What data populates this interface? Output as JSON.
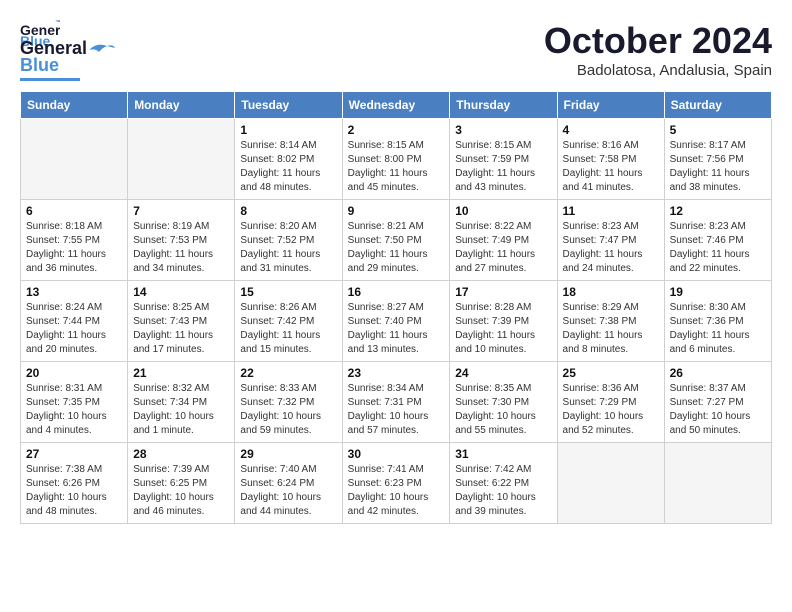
{
  "header": {
    "logo": "GeneralBlue",
    "logo_part1": "General",
    "logo_part2": "Blue",
    "month": "October 2024",
    "location": "Badolatosa, Andalusia, Spain"
  },
  "weekdays": [
    "Sunday",
    "Monday",
    "Tuesday",
    "Wednesday",
    "Thursday",
    "Friday",
    "Saturday"
  ],
  "weeks": [
    [
      {
        "day": "",
        "empty": true
      },
      {
        "day": "",
        "empty": true
      },
      {
        "day": "1",
        "sunrise": "8:14 AM",
        "sunset": "8:02 PM",
        "daylight": "11 hours and 48 minutes."
      },
      {
        "day": "2",
        "sunrise": "8:15 AM",
        "sunset": "8:00 PM",
        "daylight": "11 hours and 45 minutes."
      },
      {
        "day": "3",
        "sunrise": "8:15 AM",
        "sunset": "7:59 PM",
        "daylight": "11 hours and 43 minutes."
      },
      {
        "day": "4",
        "sunrise": "8:16 AM",
        "sunset": "7:58 PM",
        "daylight": "11 hours and 41 minutes."
      },
      {
        "day": "5",
        "sunrise": "8:17 AM",
        "sunset": "7:56 PM",
        "daylight": "11 hours and 38 minutes."
      }
    ],
    [
      {
        "day": "6",
        "sunrise": "8:18 AM",
        "sunset": "7:55 PM",
        "daylight": "11 hours and 36 minutes."
      },
      {
        "day": "7",
        "sunrise": "8:19 AM",
        "sunset": "7:53 PM",
        "daylight": "11 hours and 34 minutes."
      },
      {
        "day": "8",
        "sunrise": "8:20 AM",
        "sunset": "7:52 PM",
        "daylight": "11 hours and 31 minutes."
      },
      {
        "day": "9",
        "sunrise": "8:21 AM",
        "sunset": "7:50 PM",
        "daylight": "11 hours and 29 minutes."
      },
      {
        "day": "10",
        "sunrise": "8:22 AM",
        "sunset": "7:49 PM",
        "daylight": "11 hours and 27 minutes."
      },
      {
        "day": "11",
        "sunrise": "8:23 AM",
        "sunset": "7:47 PM",
        "daylight": "11 hours and 24 minutes."
      },
      {
        "day": "12",
        "sunrise": "8:23 AM",
        "sunset": "7:46 PM",
        "daylight": "11 hours and 22 minutes."
      }
    ],
    [
      {
        "day": "13",
        "sunrise": "8:24 AM",
        "sunset": "7:44 PM",
        "daylight": "11 hours and 20 minutes."
      },
      {
        "day": "14",
        "sunrise": "8:25 AM",
        "sunset": "7:43 PM",
        "daylight": "11 hours and 17 minutes."
      },
      {
        "day": "15",
        "sunrise": "8:26 AM",
        "sunset": "7:42 PM",
        "daylight": "11 hours and 15 minutes."
      },
      {
        "day": "16",
        "sunrise": "8:27 AM",
        "sunset": "7:40 PM",
        "daylight": "11 hours and 13 minutes."
      },
      {
        "day": "17",
        "sunrise": "8:28 AM",
        "sunset": "7:39 PM",
        "daylight": "11 hours and 10 minutes."
      },
      {
        "day": "18",
        "sunrise": "8:29 AM",
        "sunset": "7:38 PM",
        "daylight": "11 hours and 8 minutes."
      },
      {
        "day": "19",
        "sunrise": "8:30 AM",
        "sunset": "7:36 PM",
        "daylight": "11 hours and 6 minutes."
      }
    ],
    [
      {
        "day": "20",
        "sunrise": "8:31 AM",
        "sunset": "7:35 PM",
        "daylight": "10 hours and 4 minutes."
      },
      {
        "day": "21",
        "sunrise": "8:32 AM",
        "sunset": "7:34 PM",
        "daylight": "10 hours and 1 minute."
      },
      {
        "day": "22",
        "sunrise": "8:33 AM",
        "sunset": "7:32 PM",
        "daylight": "10 hours and 59 minutes."
      },
      {
        "day": "23",
        "sunrise": "8:34 AM",
        "sunset": "7:31 PM",
        "daylight": "10 hours and 57 minutes."
      },
      {
        "day": "24",
        "sunrise": "8:35 AM",
        "sunset": "7:30 PM",
        "daylight": "10 hours and 55 minutes."
      },
      {
        "day": "25",
        "sunrise": "8:36 AM",
        "sunset": "7:29 PM",
        "daylight": "10 hours and 52 minutes."
      },
      {
        "day": "26",
        "sunrise": "8:37 AM",
        "sunset": "7:27 PM",
        "daylight": "10 hours and 50 minutes."
      }
    ],
    [
      {
        "day": "27",
        "sunrise": "7:38 AM",
        "sunset": "6:26 PM",
        "daylight": "10 hours and 48 minutes."
      },
      {
        "day": "28",
        "sunrise": "7:39 AM",
        "sunset": "6:25 PM",
        "daylight": "10 hours and 46 minutes."
      },
      {
        "day": "29",
        "sunrise": "7:40 AM",
        "sunset": "6:24 PM",
        "daylight": "10 hours and 44 minutes."
      },
      {
        "day": "30",
        "sunrise": "7:41 AM",
        "sunset": "6:23 PM",
        "daylight": "10 hours and 42 minutes."
      },
      {
        "day": "31",
        "sunrise": "7:42 AM",
        "sunset": "6:22 PM",
        "daylight": "10 hours and 39 minutes."
      },
      {
        "day": "",
        "empty": true
      },
      {
        "day": "",
        "empty": true
      }
    ]
  ]
}
